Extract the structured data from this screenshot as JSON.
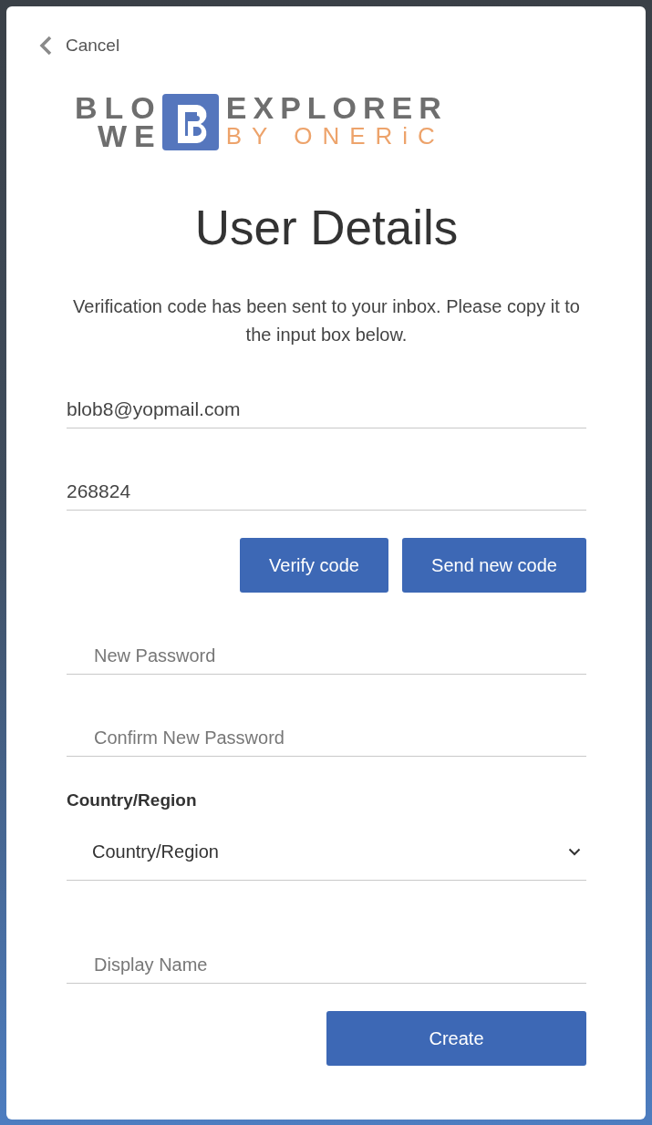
{
  "cancel_link": {
    "label": "Cancel"
  },
  "logo": {
    "top_left": "BLO",
    "bottom_left": "WE",
    "top_right": "EXPLORER",
    "bottom_right": "BY ONERiC"
  },
  "title": "User Details",
  "intro": "Verification code has been sent to your inbox. Please copy it to the input box below.",
  "verification_fields": [
    {
      "kind": "readonly",
      "value": "blob8@yopmail.com"
    },
    {
      "kind": "readonly",
      "value": "268824"
    }
  ],
  "verification_buttons": [
    "Verify code",
    "Send new code"
  ],
  "password_fields": [
    {
      "kind": "password",
      "placeholder": "New Password"
    },
    {
      "kind": "password",
      "placeholder": "Confirm New Password"
    }
  ],
  "country": {
    "label": "Country/Region",
    "placeholder": "Country/Region"
  },
  "display_name": {
    "kind": "text",
    "placeholder": "Display Name"
  },
  "submit_button": "Create"
}
